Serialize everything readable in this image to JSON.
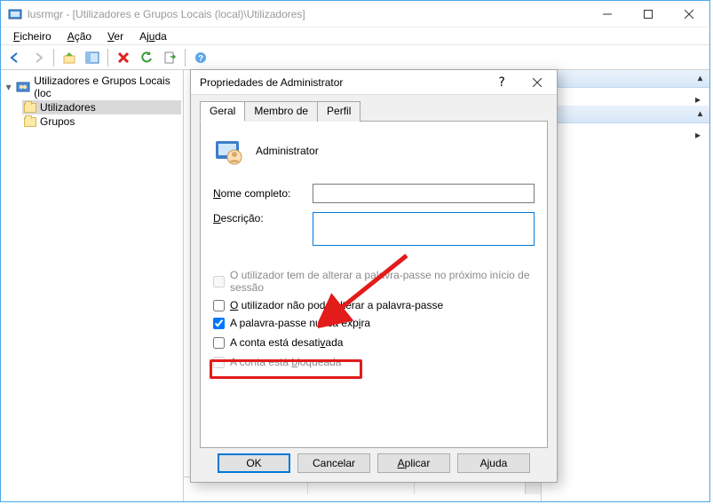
{
  "window": {
    "title": "lusrmgr - [Utilizadores e Grupos Locais (local)\\Utilizadores]"
  },
  "menu": {
    "ficheiro": "Ficheiro",
    "acao": "Ação",
    "ver": "Ver",
    "ajuda": "Ajuda"
  },
  "tree": {
    "root": "Utilizadores e Grupos Locais (loc",
    "users": "Utilizadores",
    "groups": "Grupos"
  },
  "actionpane": {
    "heading": ""
  },
  "dialog": {
    "title": "Propriedades de Administrator",
    "tabs": {
      "geral": "Geral",
      "membro": "Membro de",
      "perfil": "Perfil"
    },
    "username": "Administrator",
    "labels": {
      "nome": "Nome completo:",
      "nome_u": "N",
      "desc": "Descrição:",
      "desc_u": "D"
    },
    "fields": {
      "nome": "",
      "desc": ""
    },
    "checks": {
      "mustchange": "O utilizador tem de alterar a palavra-passe no próximo início de sessão",
      "cantchange": "O utilizador não pode alterar a palavra-passe",
      "cantchange_u": "O",
      "neverexp": "A palavra-passe nunca expira",
      "neverexp_u": "i",
      "disabled": "A conta está desativada",
      "disabled_u": "v",
      "locked": "A conta está bloqueada",
      "locked_u": "b"
    },
    "buttons": {
      "ok": "OK",
      "cancel": "Cancelar",
      "apply": "Aplicar",
      "help": "Ajuda"
    }
  }
}
